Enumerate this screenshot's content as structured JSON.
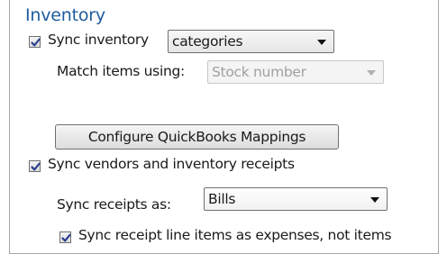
{
  "section": {
    "title": "Inventory"
  },
  "sync_inventory": {
    "checked": true,
    "label": "Sync inventory",
    "select_value": "categories"
  },
  "match_items": {
    "label": "Match items using:",
    "select_value": "Stock number",
    "disabled": true
  },
  "configure_button": {
    "label": "Configure QuickBooks Mappings"
  },
  "sync_vendors": {
    "checked": true,
    "label": "Sync vendors and inventory receipts"
  },
  "sync_receipts_as": {
    "label": "Sync receipts as:",
    "select_value": "Bills"
  },
  "sync_line_items": {
    "checked": true,
    "label": "Sync receipt line items as expenses, not items"
  }
}
